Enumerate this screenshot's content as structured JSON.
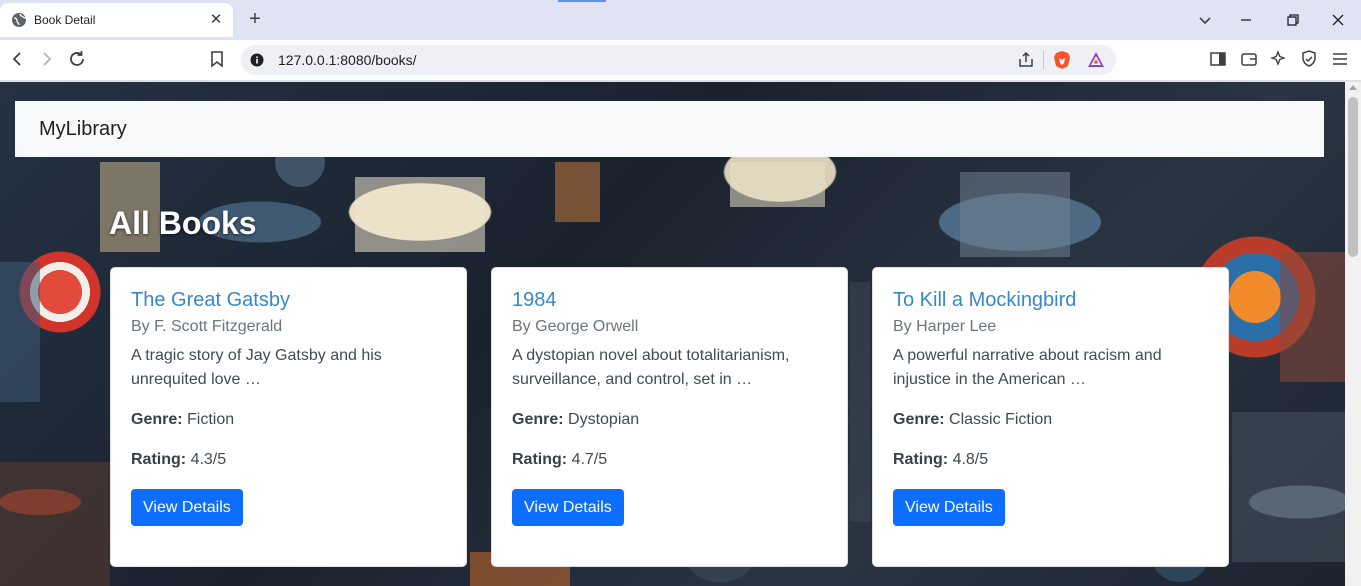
{
  "browser": {
    "tab_title": "Book Detail",
    "url": "127.0.0.1:8080/books/"
  },
  "site": {
    "brand": "MyLibrary",
    "heading": "All Books"
  },
  "labels": {
    "genre": "Genre:",
    "rating": "Rating:"
  },
  "books": [
    {
      "title": "The Great Gatsby",
      "author": "By F. Scott Fitzgerald",
      "description": "A tragic story of Jay Gatsby and his unrequited love …",
      "genre": "Fiction",
      "rating": "4.3/5",
      "button": "View Details"
    },
    {
      "title": "1984",
      "author": "By George Orwell",
      "description": "A dystopian novel about totalitarianism, surveillance, and control, set in …",
      "genre": "Dystopian",
      "rating": "4.7/5",
      "button": "View Details"
    },
    {
      "title": "To Kill a Mockingbird",
      "author": "By Harper Lee",
      "description": "A powerful narrative about racism and injustice in the American …",
      "genre": "Classic Fiction",
      "rating": "4.8/5",
      "button": "View Details"
    }
  ],
  "colors": {
    "link": "#3a87c8",
    "button": "#0d6efd",
    "navbar": "#f8f9fa",
    "brave": "#fb542b"
  }
}
